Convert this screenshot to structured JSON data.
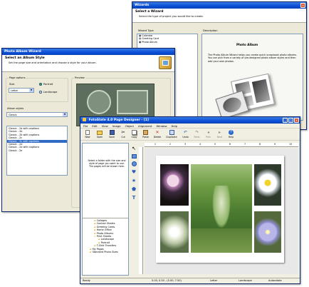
{
  "wizards": {
    "title": "Wizards",
    "header_title": "Select a Wizard",
    "header_sub": "Select the type of project you would like to create.",
    "type_label": "Wizard Type",
    "types": [
      "Calendar",
      "Greeting Card",
      "Photo Album"
    ],
    "desc_label": "Description",
    "desc_title": "Photo Album",
    "desc_text": "The Photo Album Wizard helps you create quick scrapbook photo albums. You can pick from a variety of pre-designed photo album styles and then add your own photos."
  },
  "album": {
    "title": "Photo Album Wizard",
    "header_title": "Select an Album Style",
    "header_sub": "Set the page size and orientation and choose a style for your album.",
    "page_options_label": "Page options",
    "size_label": "Size",
    "size_value": "Letter",
    "portrait_label": "Portrait",
    "landscape_label": "Landscape",
    "preview_label": "Preview",
    "styles_label": "Album styles",
    "styles_value": "Classic",
    "styles": [
      "Classic - 2a with captions",
      "Classic - 2b",
      "Classic - 2b with captions",
      "Classic - 2c",
      "Classic - 2c with captions",
      "Classic - 2d",
      "Classic - 2d with captions",
      "Classic - 2e"
    ],
    "selected_index": 4
  },
  "designer": {
    "title": "FotoSlate 4.0 Page Designer - [1]",
    "menu": [
      "File",
      "Edit",
      "View",
      "Image",
      "Object",
      "Alignment",
      "Window",
      "Help"
    ],
    "toolbar": [
      "New",
      "Open",
      "Save",
      "Cut",
      "Copy",
      "Paste",
      "Delete",
      "Duplicate",
      "Undo",
      "Redo",
      "Prev",
      "Next",
      "Help"
    ],
    "ruler": [
      "1",
      "2",
      "3",
      "4",
      "5",
      "6",
      "7",
      "8",
      "9",
      "10"
    ],
    "folder_hint": "Select a folder with the size and style of page you want to use. The pages will be shown here.",
    "tree": [
      "Collages",
      "Contact Sheets",
      "Greeting Cards",
      "Home Office",
      "Photo Albums",
      "Print Sheets",
      "Landscape",
      "Portrait",
      "T-Shirt Transfers",
      "My Pages",
      "Standard Photo Sizes"
    ],
    "status": {
      "ready": "Ready",
      "coords": "5.00, 0.50 - (5.00, 7.50)",
      "paper": "Letter",
      "orient": "Landscape",
      "mode": "Autorotate"
    }
  }
}
